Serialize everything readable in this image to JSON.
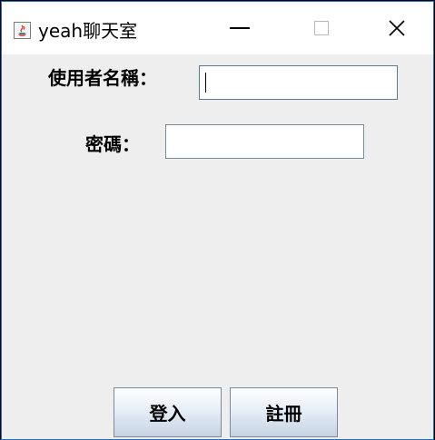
{
  "window": {
    "title": "yeah聊天室",
    "icon": "java-coffee-cup-icon",
    "controls": {
      "minimize": "minimize-icon",
      "maximize": "maximize-icon",
      "close": "close-icon",
      "close_glyph": "✕"
    }
  },
  "form": {
    "username_label": "使用者名稱：",
    "username_value": "",
    "password_label": "密碼：",
    "password_value": ""
  },
  "buttons": {
    "login_label": "登入",
    "register_label": "註冊"
  },
  "colors": {
    "window_border": "#1e6fbd",
    "background": "#eeeeee",
    "titlebar": "#ffffff"
  }
}
